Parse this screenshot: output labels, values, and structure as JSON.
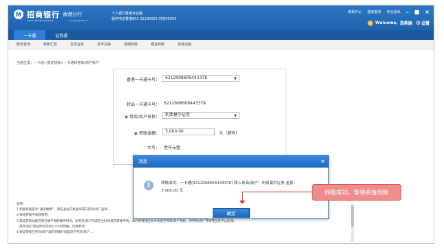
{
  "header": {
    "logo_mark": "M",
    "bank_name": "招商银行",
    "branch_name": "香港分行",
    "bank_name_en": "CHINA MERCHANTS BANK",
    "branch_name_en": "Hong Kong Branch",
    "desc_line1": "个人银行香港专业版",
    "desc_line2": "服务电话香港852-31195555 内地95555",
    "links": [
      "帮助中心",
      "重新登录",
      "安全退出"
    ],
    "window_buttons": [
      "–",
      "■",
      "×"
    ],
    "welcome": "Welcome,",
    "user": "郑勇旗",
    "settings": "设置"
  },
  "tabs": [
    {
      "label": "一卡通",
      "active": true
    },
    {
      "label": "证券通",
      "active": false
    }
  ],
  "subnav": [
    "账务查询",
    "转账汇款",
    "支票业务",
    "货币兑换",
    "定期存款",
    "银证转账",
    "其他功能"
  ],
  "breadcrumb": "当前位置：一卡通>银证转账>一卡通转券商/商户账户",
  "form": {
    "card_label": "香港一卡通卡号：",
    "card_value": "6212998606443378",
    "out_label": "转出一卡通卡号：",
    "out_value": "6212998606443378",
    "merchant_label": "券商/商户名称：",
    "merchant_value": "利弗莫尔证券",
    "amount_label": "转账金额：",
    "amount_value": "3,000.00",
    "amount_unit": "元（港币）",
    "upper_label": "大写：",
    "upper_value": "叁仟元整"
  },
  "dialog": {
    "title": "消息",
    "close": "×",
    "icon": "i",
    "message_line1": "转账成功，一卡通(6212998606443378) 转入券商/商户：利弗莫尔证券 金额：",
    "message_line2": "3,000.00 元",
    "ok_label": "确定"
  },
  "annotation": "转账成功，等待资金到账",
  "notes": [
    "说明：",
    "1.如果系统提示“通讯故障”，请先通过交易查询或向券商/商户查询…",
    "2.银证转账不收取费用。",
    "3.银证转账功能在银行端不限制服务时间，如券商/商户的非营业时间提交转账申请，本行将将相应指令发送至券商/商户系统，待券商/商户开始营业后予以处理。",
    "（券商/商户营业时间内约2-4小时到账，仅供参考）",
    "4.银证转账在券商/商户端的到账时间取决于券商/商户…"
  ]
}
